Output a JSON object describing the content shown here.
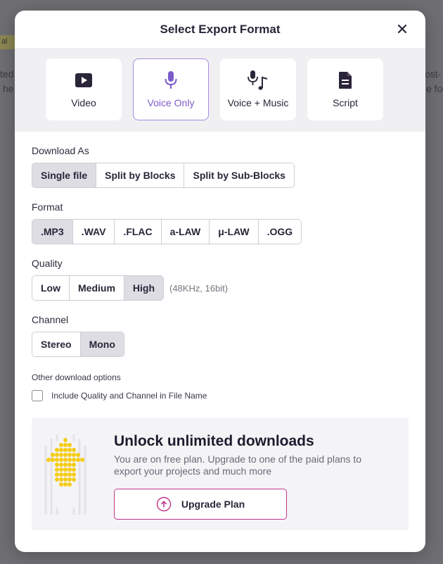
{
  "background": {
    "chip_text": "al",
    "left_fragments": [
      "ted",
      "he"
    ],
    "right_fragments": [
      "ost-",
      "e fo"
    ]
  },
  "modal": {
    "title": "Select Export Format",
    "close_icon": "close-icon"
  },
  "format_tabs": [
    {
      "label": "Video",
      "icon": "video-play-icon",
      "active": false
    },
    {
      "label": "Voice Only",
      "icon": "microphone-icon",
      "active": true
    },
    {
      "label": "Voice + Music",
      "icon": "mic-music-icon",
      "active": false
    },
    {
      "label": "Script",
      "icon": "document-icon",
      "active": false
    }
  ],
  "download_as": {
    "label": "Download As",
    "options": [
      "Single file",
      "Split by Blocks",
      "Split by Sub-Blocks"
    ],
    "selected": "Single file"
  },
  "format": {
    "label": "Format",
    "options": [
      ".MP3",
      ".WAV",
      ".FLAC",
      "a-LAW",
      "μ-LAW",
      ".OGG"
    ],
    "selected": ".MP3"
  },
  "quality": {
    "label": "Quality",
    "options": [
      "Low",
      "Medium",
      "High"
    ],
    "selected": "High",
    "hint": "(48KHz, 16bit)"
  },
  "channel": {
    "label": "Channel",
    "options": [
      "Stereo",
      "Mono"
    ],
    "selected": "Mono"
  },
  "other_options": {
    "label": "Other download options",
    "checkbox_label": "Include Quality and Channel in File Name",
    "checked": false
  },
  "upsell": {
    "title": "Unlock unlimited downloads",
    "text": "You are on free plan. Upgrade to one of the paid plans to export your projects and much more",
    "button_label": "Upgrade Plan",
    "button_icon": "arrow-up-circle-icon"
  },
  "colors": {
    "accent_purple": "#7c5cc8",
    "active_border": "#a88be0",
    "upgrade_border": "#c0368a",
    "arrow_yellow": "#f5cc17"
  }
}
